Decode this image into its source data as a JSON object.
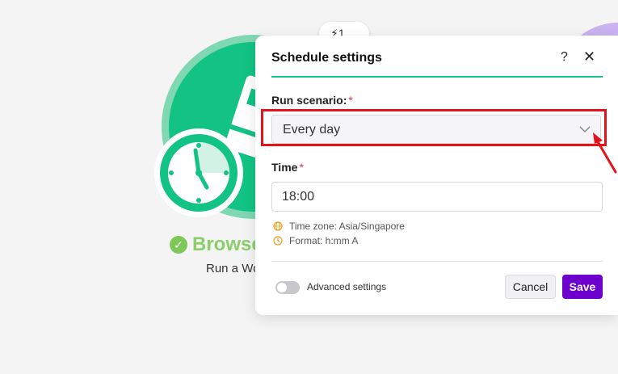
{
  "canvas": {
    "module_tab_label": "⚡1",
    "node_title": "Browse",
    "node_subtitle": "Run a Wo",
    "accent_color": "#12c383"
  },
  "dialog": {
    "title": "Schedule settings",
    "help_label": "?",
    "close_label": "✕",
    "run_scenario": {
      "label": "Run scenario:",
      "required_mark": "*",
      "selected": "Every day"
    },
    "time": {
      "label": "Time",
      "required_mark": "*",
      "value": "18:00"
    },
    "hints": {
      "timezone": "Time zone: Asia/Singapore",
      "format": "Format: h:mm A"
    },
    "advanced_settings_label": "Advanced settings",
    "advanced_settings_enabled": false,
    "cancel_label": "Cancel",
    "save_label": "Save",
    "save_color": "#6d00cc"
  }
}
